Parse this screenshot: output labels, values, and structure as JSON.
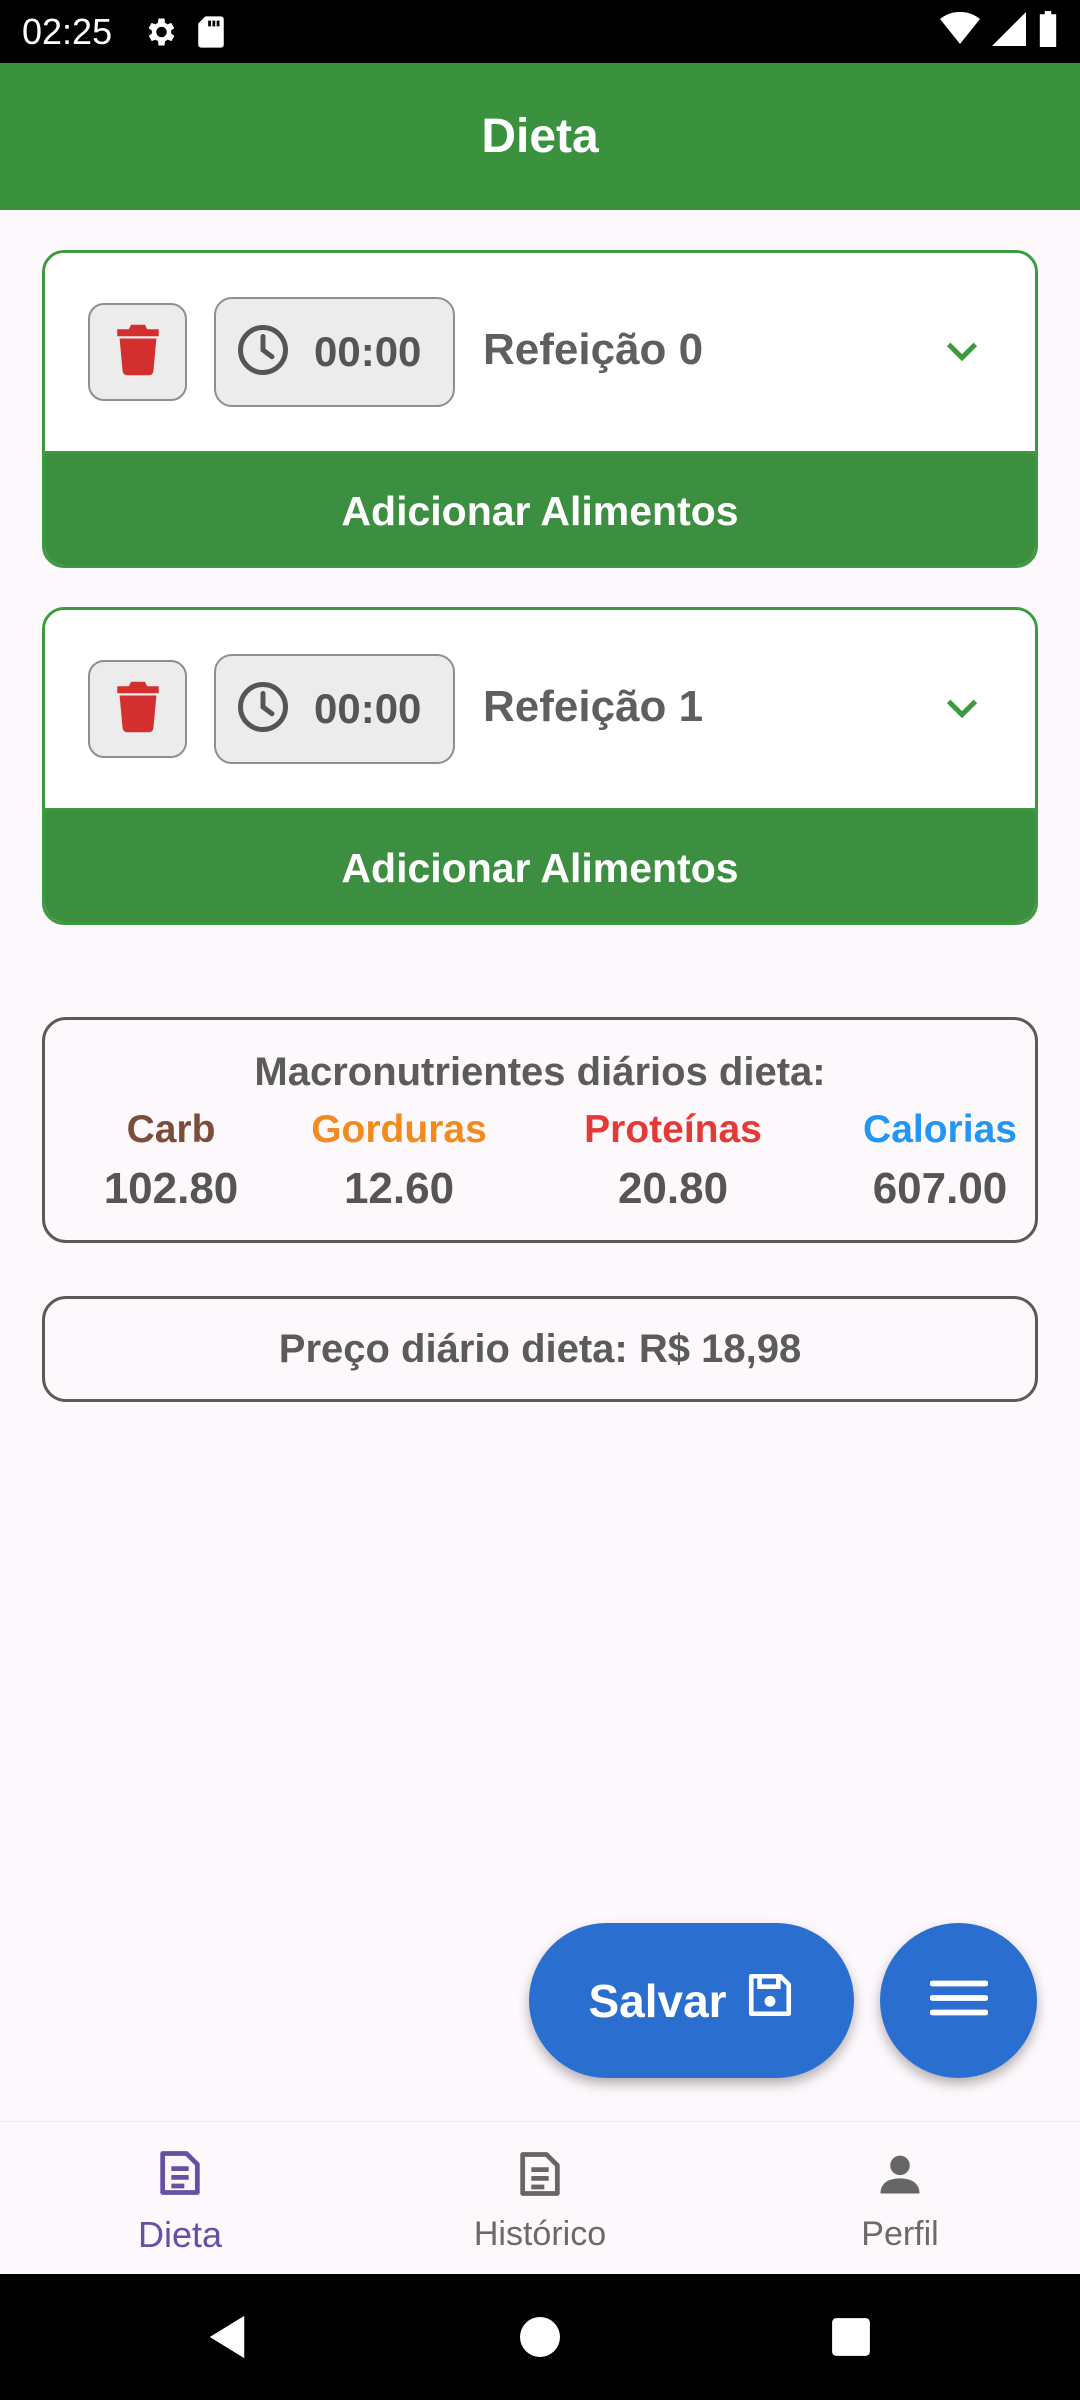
{
  "status_bar": {
    "time": "02:25"
  },
  "app_bar": {
    "title": "Dieta"
  },
  "meals": [
    {
      "time": "00:00",
      "name": "Refeição 0",
      "add_label": "Adicionar Alimentos"
    },
    {
      "time": "00:00",
      "name": "Refeição 1",
      "add_label": "Adicionar Alimentos"
    }
  ],
  "macros": {
    "title": "Macronutrientes diários dieta:",
    "items": [
      {
        "label": "Carb",
        "value": "102.80",
        "color": "#7b4d3a"
      },
      {
        "label": "Gorduras",
        "value": "12.60",
        "color": "#f28b1f"
      },
      {
        "label": "Proteínas",
        "value": "20.80",
        "color": "#e53935"
      },
      {
        "label": "Calorias",
        "value": "607.00",
        "color": "#2196f3"
      }
    ]
  },
  "price": {
    "text": "Preço diário dieta: R$ 18,98"
  },
  "fab": {
    "save_label": "Salvar"
  },
  "bottom_nav": {
    "items": [
      {
        "label": "Dieta",
        "icon": "document-icon",
        "active": true
      },
      {
        "label": "Histórico",
        "icon": "document-icon",
        "active": false
      },
      {
        "label": "Perfil",
        "icon": "person-icon",
        "active": false
      }
    ]
  },
  "colors": {
    "primary_green": "#3b923e",
    "fab_blue": "#2a6fcf",
    "delete_red": "#d32f2f",
    "nav_active": "#6750a4"
  }
}
